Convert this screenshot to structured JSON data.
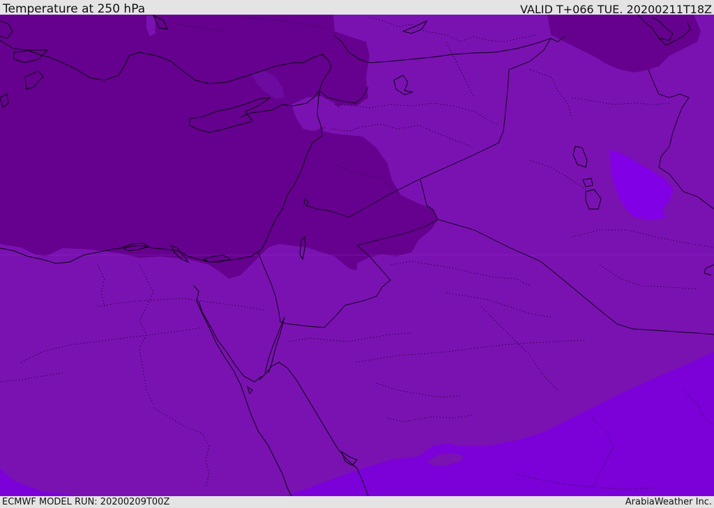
{
  "header": {
    "title": "Temperature at 250 hPa",
    "valid_time": "VALID T+066 TUE. 20200211T18Z"
  },
  "footer": {
    "model_run": "ECMWF MODEL RUN: 20200209T00Z",
    "credit": "ArabiaWeather Inc."
  },
  "map": {
    "colors": {
      "base": "#7a12b2",
      "cold": "#66008f",
      "cool": "#6d0aa0",
      "warm_band": "#7c00d8",
      "warm_patch": "#8200e6",
      "coastline": "#0a0010"
    }
  }
}
